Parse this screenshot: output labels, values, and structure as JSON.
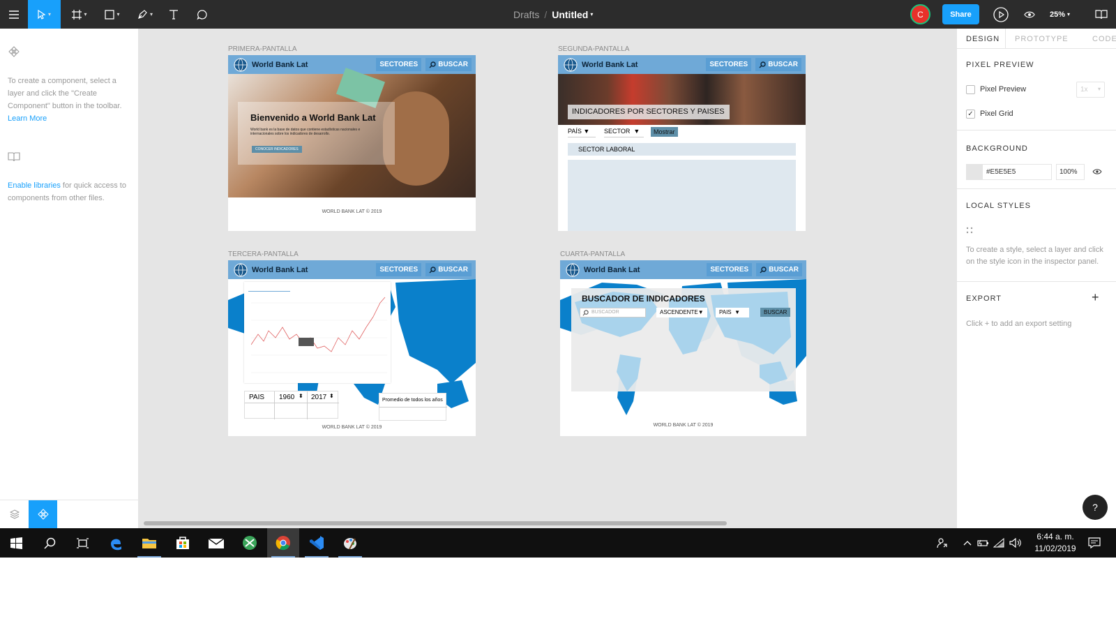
{
  "toolbar": {
    "breadcrumb_root": "Drafts",
    "breadcrumb_sep": "/",
    "file_name": "Untitled",
    "avatar_initial": "C",
    "share_label": "Share",
    "zoom_label": "25%"
  },
  "left_panel": {
    "components_hint": "To create a component, select a layer and click the \"Create Component\" button in the toolbar.",
    "learn_more": "Learn More",
    "enable_libraries": "Enable libraries",
    "libraries_hint": " for quick access to components from other files."
  },
  "frames": {
    "f1": {
      "label": "PRIMERA-PANTALLA",
      "brand": "World Bank Lat",
      "nav_sectores": "SECTORES",
      "nav_buscar": "BUSCAR",
      "hero_title": "Bienvenido a World Bank Lat",
      "hero_text": "World bank es la base de datos que contiene estadísticas nacionales e internacionales sobre los indicadores de desarrollo.",
      "hero_button": "CONOCER INDICADORES",
      "footer": "WORLD BANK LAT © 2019"
    },
    "f2": {
      "label": "SEGUNDA-PANTALLA",
      "brand": "World Bank Lat",
      "nav_sectores": "SECTORES",
      "nav_buscar": "BUSCAR",
      "banner": "INDICADORES POR SECTORES Y PAISES",
      "pais": "PAÍS",
      "sector": "SECTOR",
      "mostrar": "Mostrar",
      "sector_laboral": "SECTOR LABORAL"
    },
    "f3": {
      "label": "TERCERA-PANTALLA",
      "brand": "World Bank Lat",
      "nav_sectores": "SECTORES",
      "nav_buscar": "BUSCAR",
      "pais": "PAIS",
      "year_from": "1960",
      "year_to": "2017",
      "promedio": "Promedio de todos los años",
      "footer": "WORLD BANK LAT © 2019"
    },
    "f4": {
      "label": "CUARTA-PANTALLA",
      "brand": "World Bank Lat",
      "nav_sectores": "SECTORES",
      "nav_buscar": "BUSCAR",
      "buscador_title": "BUSCADOR DE INDICADORES",
      "buscador_placeholder": "BUSCADOR",
      "ascendente": "ASCENDENTE",
      "pais": "PAIS",
      "buscar_btn": "BUSCAR",
      "footer": "WORLD BANK LAT © 2019"
    }
  },
  "right_panel": {
    "tab_design": "DESIGN",
    "tab_prototype": "PROTOTYPE",
    "tab_code": "CODE",
    "pixel_preview_h": "PIXEL PREVIEW",
    "pixel_preview": "Pixel Preview",
    "pixel_preview_scale": "1x",
    "pixel_grid": "Pixel Grid",
    "background_h": "BACKGROUND",
    "bg_hex": "#E5E5E5",
    "bg_opacity": "100%",
    "local_styles_h": "LOCAL STYLES",
    "local_styles_hint": "To create a style, select a layer and click on the style icon in the inspector panel.",
    "export_h": "EXPORT",
    "export_hint": "Click + to add an export setting",
    "help": "?"
  },
  "taskbar": {
    "time": "6:44 a. m.",
    "date": "11/02/2019"
  },
  "colors": {
    "accent": "#18a0fb",
    "toolbar_bg": "#2c2c2c",
    "canvas_bg": "#e5e5e5",
    "wb_bar": "#6fa9d7",
    "map_blue": "#0a80cb",
    "avatar": "#e8312a"
  }
}
